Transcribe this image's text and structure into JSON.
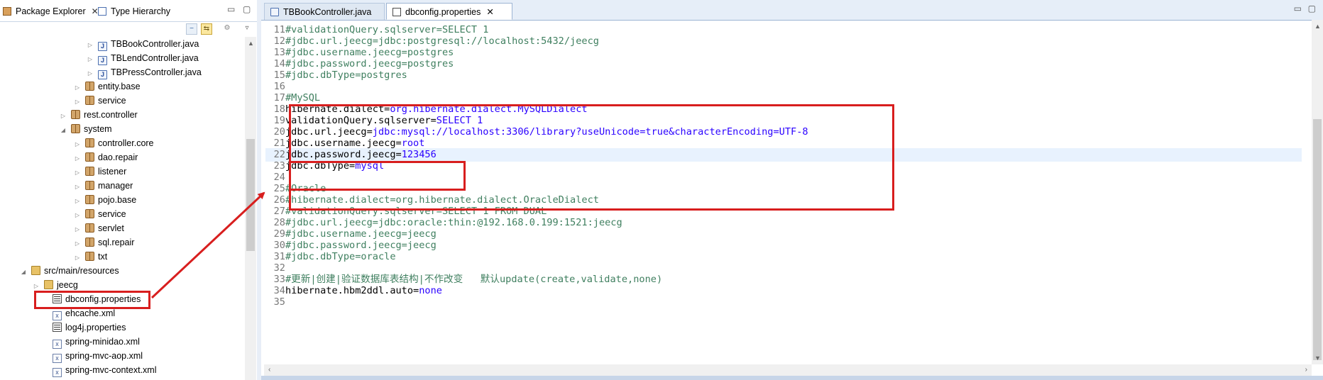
{
  "left_panel": {
    "tabs": [
      {
        "label": "Package Explorer",
        "close": "✕"
      },
      {
        "label": "Type Hierarchy"
      }
    ],
    "minimize": "▭",
    "maximize": "▢",
    "tree": [
      {
        "label": "TBBookController.java",
        "icon": "java-file-icon",
        "twisty": "▷"
      },
      {
        "label": "TBLendController.java",
        "icon": "java-file-icon",
        "twisty": "▷"
      },
      {
        "label": "TBPressController.java",
        "icon": "java-file-icon",
        "twisty": "▷"
      },
      {
        "label": "entity.base",
        "icon": "package-icon",
        "twisty": "▷"
      },
      {
        "label": "service",
        "icon": "package-icon",
        "twisty": "▷"
      },
      {
        "label": "rest.controller",
        "icon": "package-icon",
        "twisty": "▷"
      },
      {
        "label": "system",
        "icon": "package-icon",
        "twisty": "◢"
      },
      {
        "label": "controller.core",
        "icon": "package-icon",
        "twisty": "▷"
      },
      {
        "label": "dao.repair",
        "icon": "package-icon",
        "twisty": "▷"
      },
      {
        "label": "listener",
        "icon": "package-icon",
        "twisty": "▷"
      },
      {
        "label": "manager",
        "icon": "package-icon",
        "twisty": "▷"
      },
      {
        "label": "pojo.base",
        "icon": "package-icon",
        "twisty": "▷"
      },
      {
        "label": "service",
        "icon": "package-icon",
        "twisty": "▷"
      },
      {
        "label": "servlet",
        "icon": "package-icon",
        "twisty": "▷"
      },
      {
        "label": "sql.repair",
        "icon": "package-icon",
        "twisty": "▷"
      },
      {
        "label": "txt",
        "icon": "package-icon",
        "twisty": "▷"
      },
      {
        "label": "src/main/resources",
        "icon": "source-folder-icon",
        "twisty": "◢"
      },
      {
        "label": "jeecg",
        "icon": "folder-icon",
        "twisty": "▷"
      },
      {
        "label": "dbconfig.properties",
        "icon": "properties-file-icon",
        "twisty": ""
      },
      {
        "label": "ehcache.xml",
        "icon": "xml-file-icon",
        "twisty": ""
      },
      {
        "label": "log4j.properties",
        "icon": "properties-file-icon",
        "twisty": ""
      },
      {
        "label": "spring-minidao.xml",
        "icon": "xml-file-icon",
        "twisty": ""
      },
      {
        "label": "spring-mvc-aop.xml",
        "icon": "xml-file-icon",
        "twisty": ""
      },
      {
        "label": "spring-mvc-context.xml",
        "icon": "xml-file-icon",
        "twisty": ""
      }
    ]
  },
  "editor": {
    "tabs": [
      {
        "label": "TBBookController.java"
      },
      {
        "label": "dbconfig.properties",
        "close": "✕"
      }
    ],
    "minimize": "▭",
    "maximize": "▢",
    "lines": [
      {
        "n": "11",
        "key": "#validationQuery.sqlserver=SELECT 1",
        "val": "",
        "comment": true
      },
      {
        "n": "12",
        "key": "#jdbc.url.jeecg=jdbc:postgresql://localhost:5432/jeecg",
        "val": "",
        "comment": true
      },
      {
        "n": "13",
        "key": "#jdbc.username.jeecg=postgres",
        "val": "",
        "comment": true
      },
      {
        "n": "14",
        "key": "#jdbc.password.jeecg=postgres",
        "val": "",
        "comment": true
      },
      {
        "n": "15",
        "key": "#jdbc.dbType=postgres",
        "val": "",
        "comment": true
      },
      {
        "n": "16",
        "key": "",
        "val": "",
        "comment": false
      },
      {
        "n": "17",
        "key": "#MySQL",
        "val": "",
        "comment": true
      },
      {
        "n": "18",
        "key": "hibernate.dialect=",
        "val": "org.hibernate.dialect.MySQLDialect",
        "comment": false
      },
      {
        "n": "19",
        "key": "validationQuery.sqlserver=",
        "val": "SELECT 1",
        "comment": false
      },
      {
        "n": "20",
        "key": "jdbc.url.jeecg=",
        "val": "jdbc:mysql://localhost:3306/library?useUnicode=true&characterEncoding=UTF-8",
        "comment": false
      },
      {
        "n": "21",
        "key": "jdbc.username.jeecg=",
        "val": "root",
        "comment": false
      },
      {
        "n": "22",
        "key": "jdbc.password.jeecg=",
        "val": "123456",
        "comment": false
      },
      {
        "n": "23",
        "key": "jdbc.dbType=",
        "val": "mysql",
        "comment": false
      },
      {
        "n": "24",
        "key": "",
        "val": "",
        "comment": false
      },
      {
        "n": "25",
        "key": "#Oracle",
        "val": "",
        "comment": true
      },
      {
        "n": "26",
        "key": "#hibernate.dialect=org.hibernate.dialect.OracleDialect",
        "val": "",
        "comment": true
      },
      {
        "n": "27",
        "key": "#validationQuery.sqlserver=SELECT 1 FROM DUAL",
        "val": "",
        "comment": true
      },
      {
        "n": "28",
        "key": "#jdbc.url.jeecg=jdbc:oracle:thin:@192.168.0.199:1521:jeecg",
        "val": "",
        "comment": true
      },
      {
        "n": "29",
        "key": "#jdbc.username.jeecg=jeecg",
        "val": "",
        "comment": true
      },
      {
        "n": "30",
        "key": "#jdbc.password.jeecg=jeecg",
        "val": "",
        "comment": true
      },
      {
        "n": "31",
        "key": "#jdbc.dbType=oracle",
        "val": "",
        "comment": true
      },
      {
        "n": "32",
        "key": "",
        "val": "",
        "comment": false
      },
      {
        "n": "33",
        "key": "#更新|创建|验证数据库表结构|不作改变   默认update(create,validate,none)",
        "val": "",
        "comment": true
      },
      {
        "n": "34",
        "key": "hibernate.hbm2ddl.auto=",
        "val": "none",
        "comment": false
      },
      {
        "n": "35",
        "key": "",
        "val": "",
        "comment": false
      }
    ],
    "current_line": "22"
  },
  "colors": {
    "annotation": "#d81e1e",
    "comment": "#3f7f5f",
    "value": "#2a00ff",
    "current_line": "#e8f2fe"
  }
}
